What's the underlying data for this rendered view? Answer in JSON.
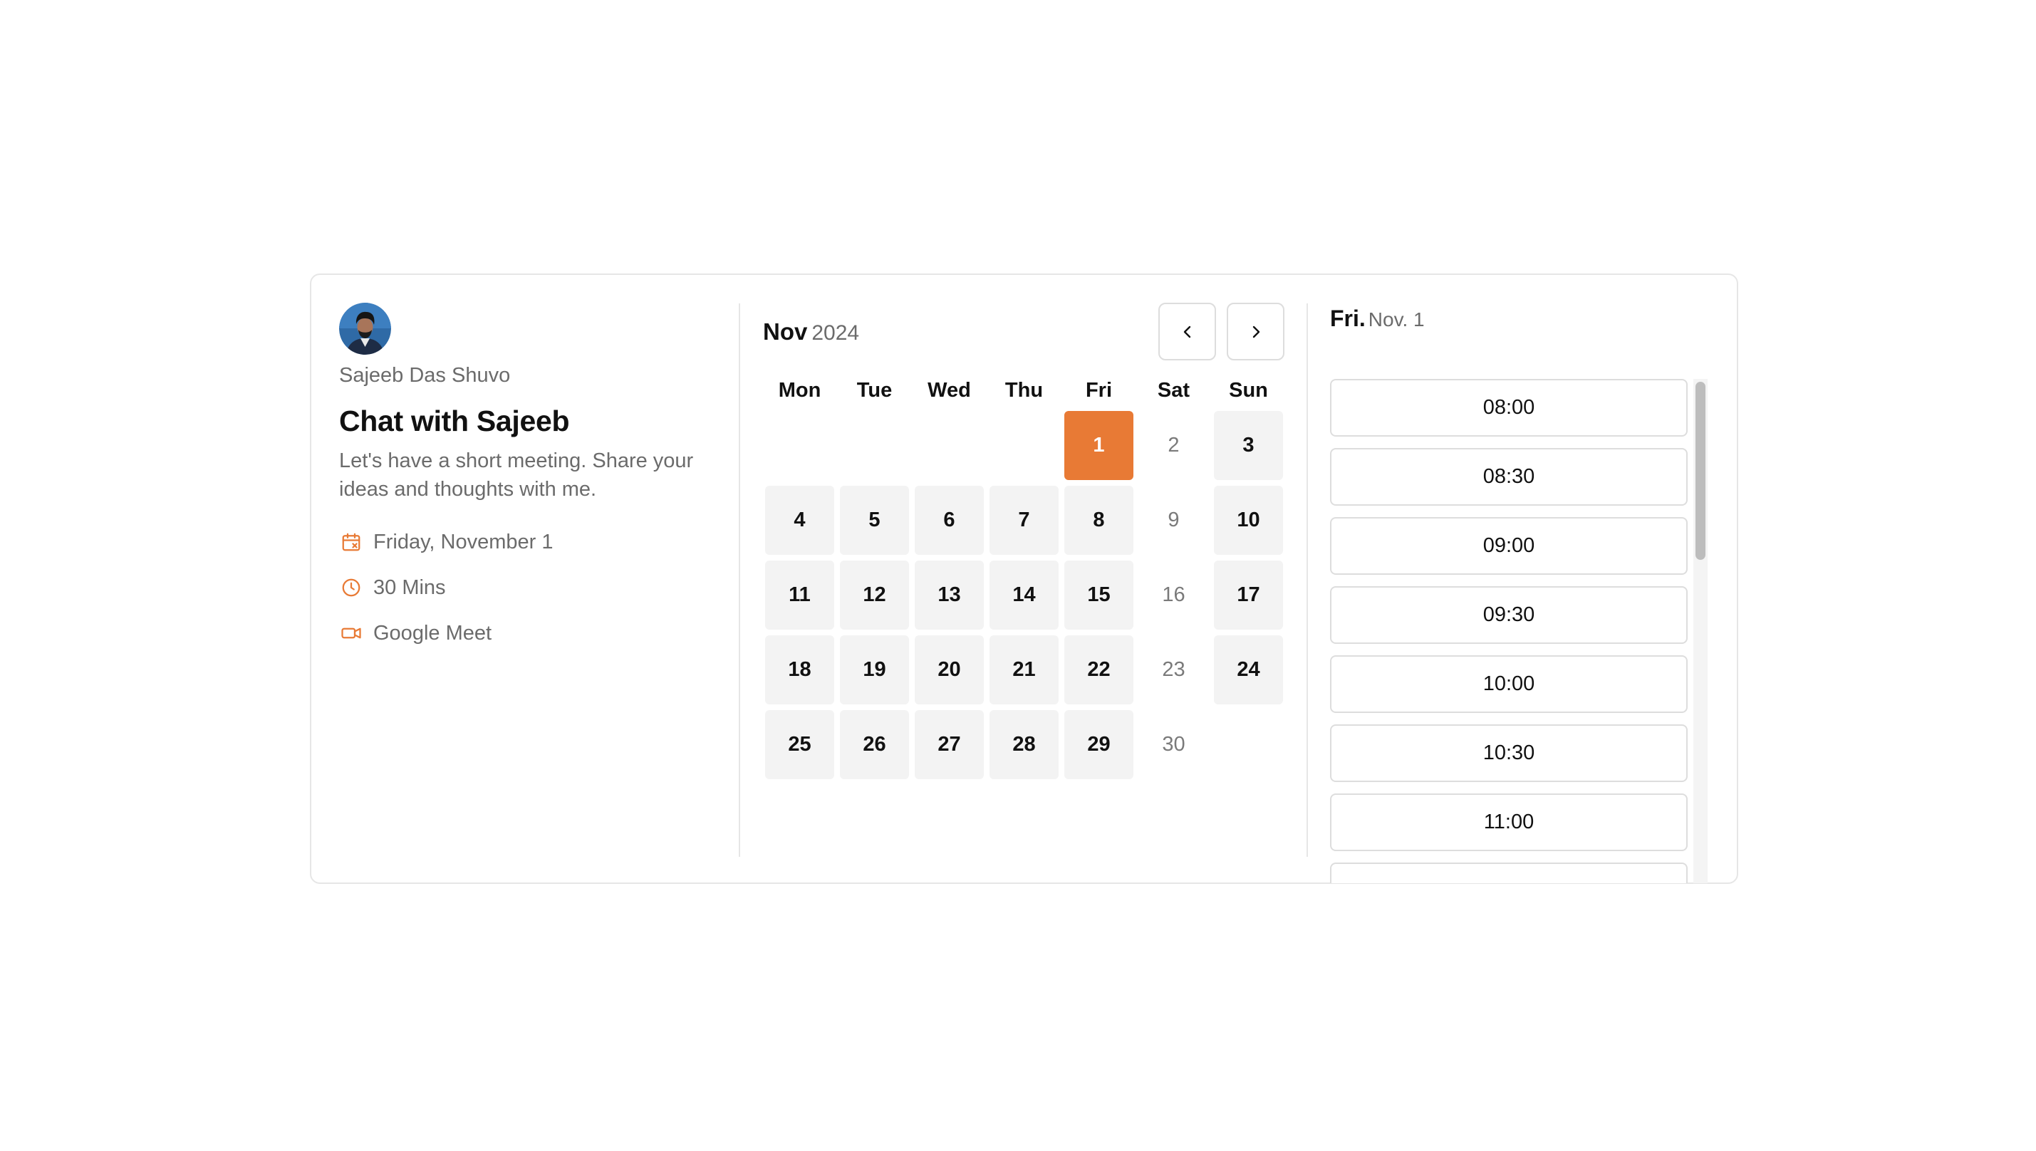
{
  "host": {
    "name": "Sajeeb Das Shuvo",
    "avatar_alt": "avatar"
  },
  "event": {
    "title": "Chat with Sajeeb",
    "description": "Let's have a short meeting. Share your ideas and thoughts with me.",
    "date": "Friday, November 1",
    "duration": "30 Mins",
    "location": "Google Meet"
  },
  "calendar": {
    "month": "Nov",
    "year": "2024",
    "weekdays": [
      "Mon",
      "Tue",
      "Wed",
      "Thu",
      "Fri",
      "Sat",
      "Sun"
    ],
    "weeks": [
      [
        {
          "d": "",
          "s": "empty"
        },
        {
          "d": "",
          "s": "empty"
        },
        {
          "d": "",
          "s": "empty"
        },
        {
          "d": "",
          "s": "empty"
        },
        {
          "d": "1",
          "s": "selected"
        },
        {
          "d": "2",
          "s": "unavail"
        },
        {
          "d": "3",
          "s": "avail"
        }
      ],
      [
        {
          "d": "4",
          "s": "avail"
        },
        {
          "d": "5",
          "s": "avail"
        },
        {
          "d": "6",
          "s": "avail"
        },
        {
          "d": "7",
          "s": "avail"
        },
        {
          "d": "8",
          "s": "avail"
        },
        {
          "d": "9",
          "s": "unavail"
        },
        {
          "d": "10",
          "s": "avail"
        }
      ],
      [
        {
          "d": "11",
          "s": "avail"
        },
        {
          "d": "12",
          "s": "avail"
        },
        {
          "d": "13",
          "s": "avail"
        },
        {
          "d": "14",
          "s": "avail"
        },
        {
          "d": "15",
          "s": "avail"
        },
        {
          "d": "16",
          "s": "unavail"
        },
        {
          "d": "17",
          "s": "avail"
        }
      ],
      [
        {
          "d": "18",
          "s": "avail"
        },
        {
          "d": "19",
          "s": "avail"
        },
        {
          "d": "20",
          "s": "avail"
        },
        {
          "d": "21",
          "s": "avail"
        },
        {
          "d": "22",
          "s": "avail"
        },
        {
          "d": "23",
          "s": "unavail"
        },
        {
          "d": "24",
          "s": "avail"
        }
      ],
      [
        {
          "d": "25",
          "s": "avail"
        },
        {
          "d": "26",
          "s": "avail"
        },
        {
          "d": "27",
          "s": "avail"
        },
        {
          "d": "28",
          "s": "avail"
        },
        {
          "d": "29",
          "s": "avail"
        },
        {
          "d": "30",
          "s": "unavail"
        },
        {
          "d": "",
          "s": "empty"
        }
      ]
    ]
  },
  "slots": {
    "day": "Fri.",
    "date": "Nov. 1",
    "times": [
      "08:00",
      "08:30",
      "09:00",
      "09:30",
      "10:00",
      "10:30",
      "11:00",
      ""
    ]
  },
  "colors": {
    "accent": "#e87a35",
    "available_bg": "#f3f3f3",
    "border": "#e6e6e6",
    "muted_text": "#6b6b6b"
  },
  "icons": {
    "date": "calendar-icon",
    "duration": "clock-icon",
    "location": "video-camera-icon",
    "prev": "chevron-left-icon",
    "next": "chevron-right-icon"
  }
}
